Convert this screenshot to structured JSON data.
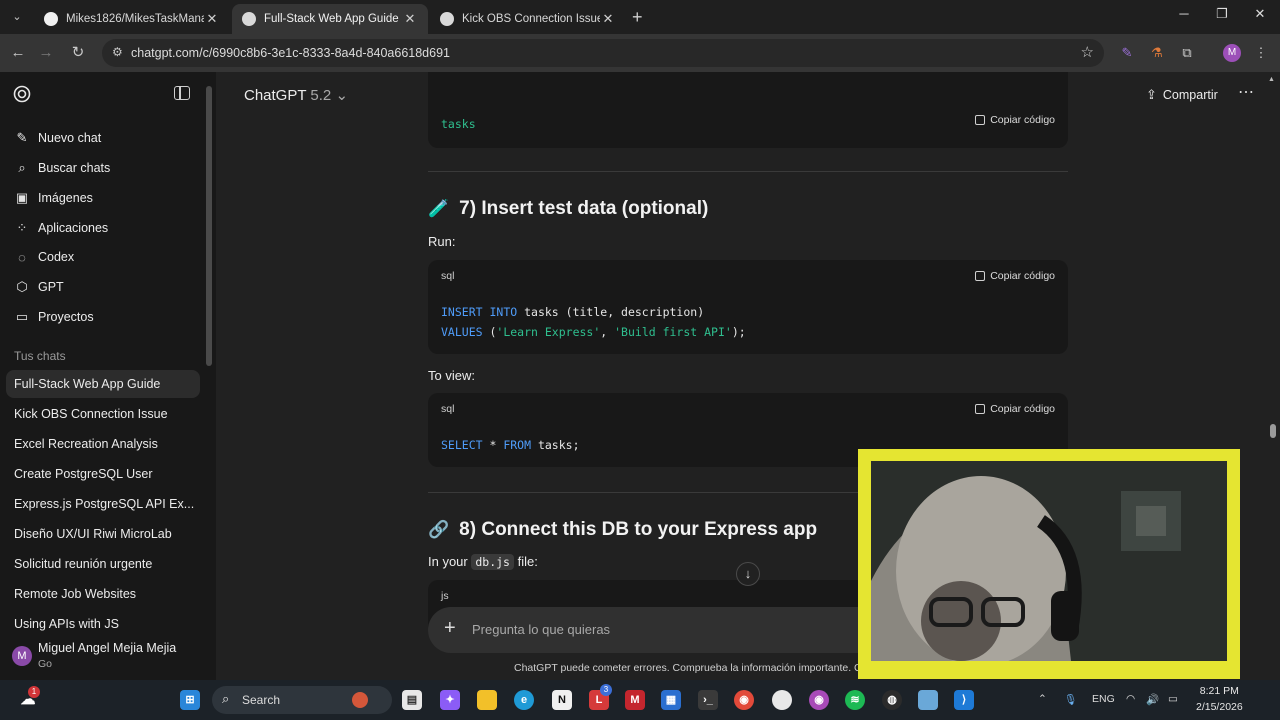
{
  "browser": {
    "tabs": [
      {
        "title": "Mikes1826/MikesTaskManager",
        "active": false
      },
      {
        "title": "Full-Stack Web App Guide",
        "active": true
      },
      {
        "title": "Kick OBS Connection Issue",
        "active": false
      }
    ],
    "url": "chatgpt.com/c/6990c8b6-3e1c-8333-8a4d-840a6618d691",
    "profile_initial": "M"
  },
  "sidebar": {
    "nav": [
      {
        "label": "Nuevo chat",
        "icon": "edit-icon"
      },
      {
        "label": "Buscar chats",
        "icon": "search-icon"
      },
      {
        "label": "Imágenes",
        "icon": "image-icon"
      },
      {
        "label": "Aplicaciones",
        "icon": "apps-icon"
      },
      {
        "label": "Codex",
        "icon": "codex-icon"
      },
      {
        "label": "GPT",
        "icon": "gpt-icon"
      },
      {
        "label": "Proyectos",
        "icon": "folder-icon"
      }
    ],
    "section_title": "Tus chats",
    "chats": [
      "Full-Stack Web App Guide",
      "Kick OBS Connection Issue",
      "Excel Recreation Analysis",
      "Create PostgreSQL User",
      "Express.js PostgreSQL API Ex...",
      "Diseño UX/UI Riwi MicroLab",
      "Solicitud reunión urgente",
      "Remote Job Websites",
      "Using APIs with JS"
    ],
    "user": {
      "initial": "M",
      "name": "Miguel Angel Mejia Mejia",
      "plan": "Go"
    }
  },
  "header": {
    "model": "ChatGPT",
    "version": "5.2",
    "share_label": "Compartir"
  },
  "content": {
    "top_code": {
      "text": "tasks",
      "copy_label": "Copiar código"
    },
    "section7": {
      "emoji": "🧪",
      "heading": "7) Insert test data (optional)"
    },
    "run_label": "Run:",
    "code_insert": {
      "lang": "sql",
      "copy_label": "Copiar código",
      "line1": {
        "kw1": "INSERT",
        "kw2": "INTO",
        "rest": " tasks (title, description)"
      },
      "line2": {
        "kw": "VALUES",
        "open": " (",
        "s1": "'Learn Express'",
        "comma": ", ",
        "s2": "'Build first API'",
        "close": ");"
      }
    },
    "view_label": "To view:",
    "code_select": {
      "lang": "sql",
      "copy_label": "Copiar código",
      "line": {
        "kw1": "SELECT",
        "mid": " * ",
        "kw2": "FROM",
        "rest": " tasks;"
      }
    },
    "section8": {
      "emoji": "🔗",
      "heading": "8) Connect this DB to your Express app"
    },
    "in_your": {
      "before": "In your ",
      "code": "db.js",
      "after": " file:"
    },
    "code_js": {
      "lang": "js"
    }
  },
  "composer": {
    "placeholder": "Pregunta lo que quieras"
  },
  "disclaimer": "ChatGPT puede cometer errores. Comprueba la información importante. Cons",
  "taskbar": {
    "search_label": "Search",
    "language": "ENG",
    "time": "8:21 PM",
    "date": "2/15/2026",
    "weather_badge": "1",
    "mail_badge": "3"
  }
}
